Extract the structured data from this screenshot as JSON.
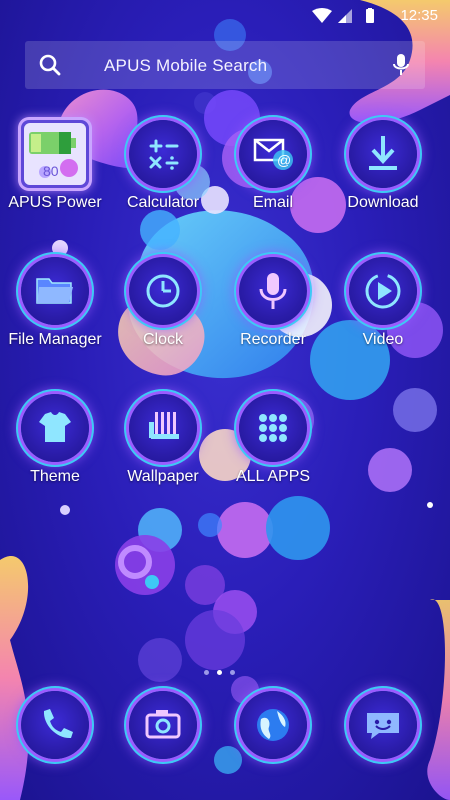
{
  "status_bar": {
    "time": "12:35",
    "icons": [
      "wifi-icon",
      "signal-icon",
      "battery-icon"
    ]
  },
  "search": {
    "placeholder": "APUS Mobile Search"
  },
  "apps": [
    {
      "label": "APUS Power",
      "icon": "battery-icon",
      "badge": "80"
    },
    {
      "label": "Calculator",
      "icon": "calculator-icon"
    },
    {
      "label": "Email",
      "icon": "email-icon"
    },
    {
      "label": "Download",
      "icon": "download-icon"
    },
    {
      "label": "File Manager",
      "icon": "folder-icon"
    },
    {
      "label": "Clock",
      "icon": "clock-icon"
    },
    {
      "label": "Recorder",
      "icon": "microphone-icon"
    },
    {
      "label": "Video",
      "icon": "play-icon"
    },
    {
      "label": "Theme",
      "icon": "tshirt-icon"
    },
    {
      "label": "Wallpaper",
      "icon": "wallpaper-icon"
    },
    {
      "label": "ALL APPS",
      "icon": "grid-icon"
    }
  ],
  "dock": [
    {
      "name": "phone",
      "icon": "phone-icon"
    },
    {
      "name": "camera",
      "icon": "camera-icon"
    },
    {
      "name": "browser",
      "icon": "globe-icon"
    },
    {
      "name": "messages",
      "icon": "chat-icon"
    }
  ],
  "page_indicator": {
    "pages": 3,
    "active": 2
  },
  "colors": {
    "background": "#2a1eb8",
    "neon_purple": "#9b5cff",
    "neon_cyan": "#3ec9f5",
    "bubble_pink": "#c46cf0",
    "bubble_blue": "#3aa8f0"
  }
}
